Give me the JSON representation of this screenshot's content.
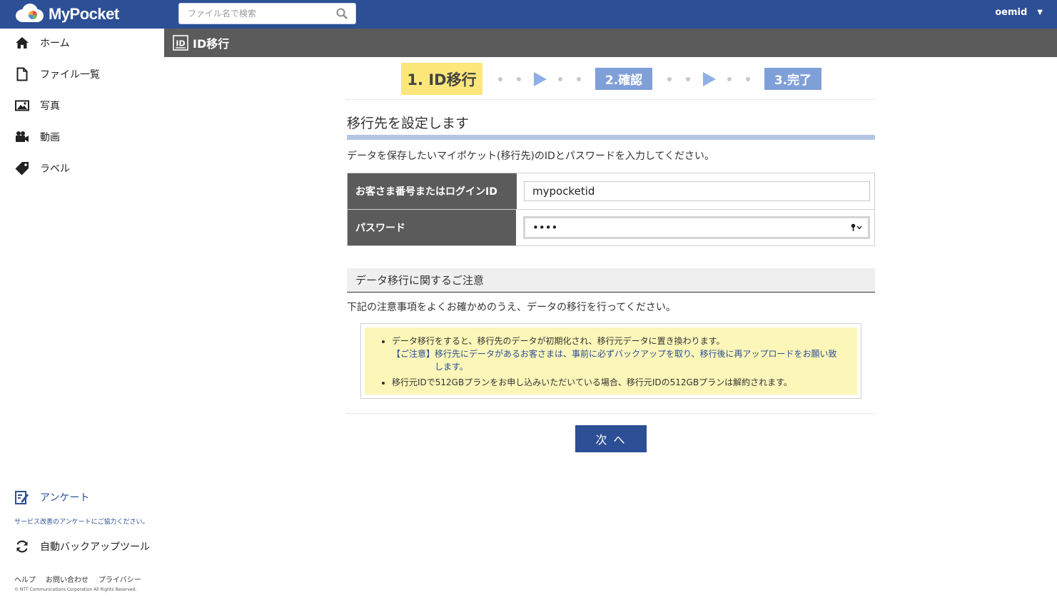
{
  "app": {
    "name": "MyPocket"
  },
  "search": {
    "placeholder": "ファイル名で検索"
  },
  "user": {
    "name": "oemid"
  },
  "sidebar": {
    "items": [
      {
        "label": "ホーム"
      },
      {
        "label": "ファイル一覧"
      },
      {
        "label": "写真"
      },
      {
        "label": "動画"
      },
      {
        "label": "ラベル"
      }
    ],
    "survey": {
      "label": "アンケート",
      "note": "サービス改善のアンケートにご協力ください。"
    },
    "backup": {
      "label": "自動バックアップツール"
    },
    "footer": {
      "help": "ヘルプ",
      "contact": "お問い合わせ",
      "privacy": "プライバシー"
    },
    "copyright": "© NTT Communications Corporation All Rights Reserved."
  },
  "page_header": {
    "title": "ID移行"
  },
  "steps": {
    "step1": "1. ID移行",
    "step2": "2.確認",
    "step3": "3.完了"
  },
  "main": {
    "section_title": "移行先を設定します",
    "intro": "データを保存したいマイポケット(移行先)のIDとパスワードを入力してください。",
    "form": {
      "login_label": "お客さま番号またはログインID",
      "login_value": "mypocketid",
      "password_label": "パスワード",
      "password_value": "••••"
    },
    "notice": {
      "title": "データ移行に関するご注意",
      "lead": "下記の注意事項をよくお確かめのうえ、データの移行を行ってください。",
      "item1": "データ移行をすると、移行先のデータが初期化され、移行元データに置き換わります。",
      "item1_warn_label": "【ご注意】",
      "item1_warn_text": "移行先にデータがあるお客さまは、事前に必ずバックアップを取り、移行後に再アップロードをお願い致します。",
      "item2": "移行元IDで512GBプランをお申し込みいただいている場合、移行元IDの512GBプランは解約されます。"
    },
    "next_button": "次 へ"
  },
  "colors": {
    "brand": "#2c4f95",
    "header_gray": "#5b5b5b",
    "step_active": "#fbe77a",
    "step_inactive": "#7f9fd8",
    "notice_bg": "#fcf6b9"
  }
}
